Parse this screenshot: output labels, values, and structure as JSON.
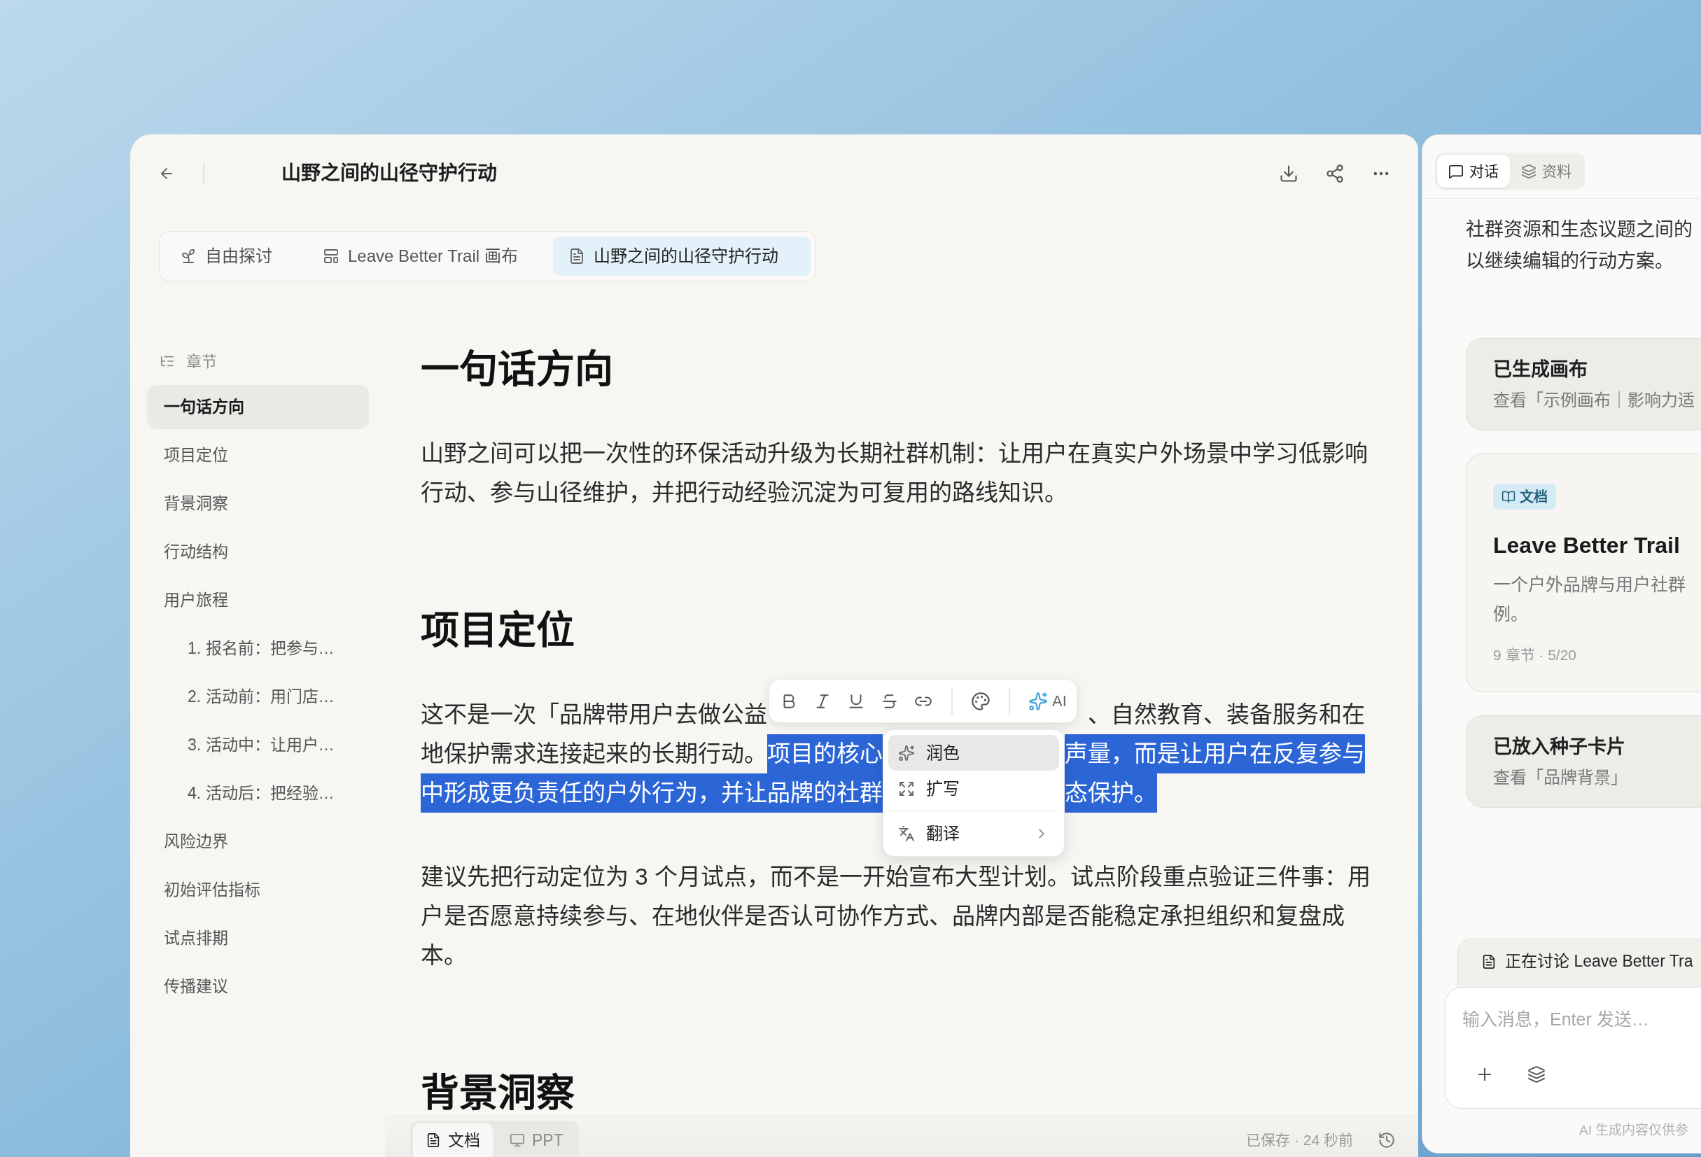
{
  "document_header": {
    "title": "山野之间的山径守护行动"
  },
  "view_tabs": [
    {
      "label": "自由探讨",
      "selected": false
    },
    {
      "label": "Leave Better Trail 画布",
      "selected": false
    },
    {
      "label": "山野之间的山径守护行动",
      "selected": true
    }
  ],
  "outline": {
    "title": "章节",
    "items": [
      {
        "label": "一句话方向",
        "selected": true
      },
      {
        "label": "项目定位",
        "selected": false
      },
      {
        "label": "背景洞察",
        "selected": false
      },
      {
        "label": "行动结构",
        "selected": false
      },
      {
        "label": "用户旅程",
        "selected": false,
        "children": [
          {
            "label": "1. 报名前：把参与…",
            "selected": false
          },
          {
            "label": "2. 活动前：用门店…",
            "selected": false
          },
          {
            "label": "3. 活动中：让用户…",
            "selected": false
          },
          {
            "label": "4. 活动后：把经验…",
            "selected": false
          }
        ]
      },
      {
        "label": "风险边界",
        "selected": false
      },
      {
        "label": "初始评估指标",
        "selected": false
      },
      {
        "label": "试点排期",
        "selected": false
      },
      {
        "label": "传播建议",
        "selected": false
      }
    ]
  },
  "document": {
    "sections": [
      {
        "heading": "一句话方向",
        "paragraphs": [
          {
            "kind": "text",
            "lines": [
              "山野之间可以把一次性的环保活动升级为长期社群机制：让用户在真实户外场景中学习低影响",
              "行动、参与山径维护，并把行动经验沉淀为可复用的路线知识。"
            ]
          }
        ]
      },
      {
        "heading": "项目定位",
        "paragraphs": [
          {
            "kind": "overlaid",
            "lines": [
              {
                "before_popup": [
                  {
                    "text": "这不是一次「品牌带用户去做公益",
                    "selected": false
                  }
                ],
                "after_popup": [
                  {
                    "text": "、自然教育、装备服务和在",
                    "selected": false
                  }
                ]
              },
              {
                "before_popup": [
                  {
                    "text": "地保护需求连接起来的长期行动。",
                    "selected": false
                  },
                  {
                    "text": "项目的核心",
                    "selected": true
                  }
                ],
                "after_popup": [
                  {
                    "text": "声量，而是让用户在反复参与",
                    "selected": true
                  }
                ]
              },
              {
                "before_popup": [
                  {
                    "text": "中形成更负责任的户外行为，并让品牌的社群",
                    "selected": true
                  }
                ],
                "after_popup": [
                  {
                    "text": "态保护。",
                    "selected": true
                  }
                ]
              }
            ]
          },
          {
            "kind": "text",
            "lines": [
              "建议先把行动定位为 3 个月试点，而不是一开始宣布大型计划。试点阶段重点验证三件事：用",
              "户是否愿意持续参与、在地伙伴是否认可协作方式、品牌内部是否能稳定承担组织和复盘成",
              "本。"
            ]
          }
        ]
      },
      {
        "heading": "背景洞察"
      }
    ]
  },
  "selection_popup": {
    "ai_label": "AI",
    "menu_groups": [
      {
        "items": [
          {
            "label": "润色",
            "selected": true,
            "submenu": false
          },
          {
            "label": "扩写",
            "selected": false,
            "submenu": false
          }
        ]
      },
      {
        "items": [
          {
            "label": "翻译",
            "selected": false,
            "submenu": true
          }
        ]
      }
    ]
  },
  "bottom_bar": {
    "modes": [
      {
        "label": "文档",
        "selected": true
      },
      {
        "label": "PPT",
        "selected": false
      }
    ],
    "save_status": "已保存 · 24 秒前"
  },
  "assistant_panel": {
    "tabs": [
      {
        "label": "对话",
        "selected": true
      },
      {
        "label": "资料",
        "selected": false
      }
    ],
    "message_lines": [
      "社群资源和生态议题之间的",
      "以继续编辑的行动方案。"
    ],
    "cards": [
      {
        "kind": "notice",
        "title": "已生成画布",
        "subtitle": "查看「示例画布｜影响力适"
      },
      {
        "kind": "document",
        "badge": "文档",
        "title": "Leave Better Trail",
        "description_lines": [
          "一个户外品牌与用户社群",
          "例。"
        ],
        "meta": "9 章节 · 5/20"
      },
      {
        "kind": "notice",
        "title": "已放入种子卡片",
        "subtitle": "查看「品牌背景」"
      }
    ],
    "context_chip": "正在讨论 Leave Better Tra",
    "composer": {
      "placeholder": "输入消息，Enter 发送…"
    },
    "disclaimer": "AI 生成内容仅供参"
  }
}
